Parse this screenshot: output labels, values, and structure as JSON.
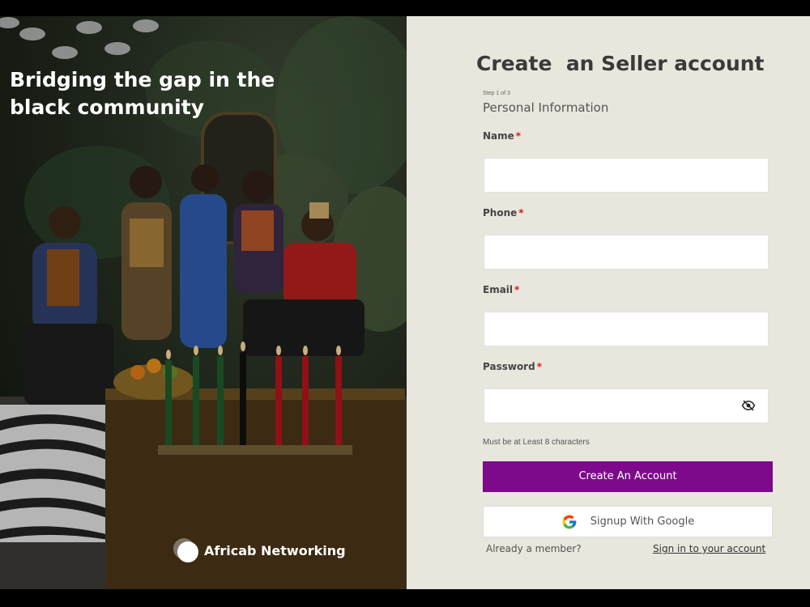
{
  "hero": {
    "headline": "Bridging the gap in the black community",
    "brand_name": "Africab Networking"
  },
  "form": {
    "title": "Create  an Seller account",
    "step": "Step 1 of 3",
    "section": "Personal Information",
    "fields": {
      "name": {
        "label": "Name",
        "required": "*",
        "value": ""
      },
      "phone": {
        "label": "Phone",
        "required": "*",
        "value": ""
      },
      "email": {
        "label": "Email",
        "required": "*",
        "value": ""
      },
      "password": {
        "label": "Password",
        "required": "*",
        "value": ""
      }
    },
    "password_hint": "Must be at Least 8 characters",
    "create_button": "Create An Account",
    "google_button": "Signup With Google",
    "member_text": "Already a member?",
    "signin_link": "Sign in to your account"
  },
  "icons": {
    "password_toggle": "eye-slash-icon",
    "google": "google-logo-icon",
    "brand": "brand-logo-icon"
  },
  "colors": {
    "primary": "#7c0a8a",
    "panel_bg": "#e9e6de",
    "required": "#d0201c"
  }
}
